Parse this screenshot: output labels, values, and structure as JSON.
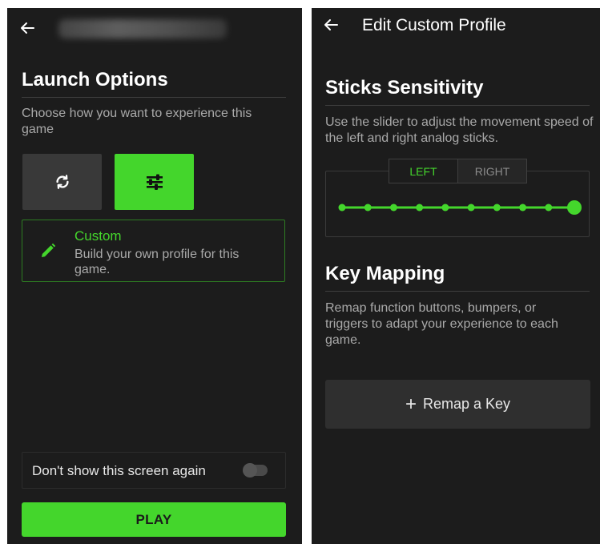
{
  "launch": {
    "heading": "Launch Options",
    "description": "Choose how you want to experience this game",
    "custom_option": {
      "title": "Custom",
      "description": "Build your own profile for this game."
    },
    "dont_show_label": "Don't show this screen again",
    "dont_show_enabled": false,
    "play_label": "PLAY",
    "icons": [
      "back-arrow-icon",
      "sync-icon",
      "sliders-icon",
      "pencil-icon"
    ]
  },
  "profile": {
    "title": "Edit Custom Profile",
    "sticks": {
      "heading": "Sticks Sensitivity",
      "description": "Use the slider to adjust the movement speed of the left and right analog sticks.",
      "tabs": [
        "LEFT",
        "RIGHT"
      ],
      "selected_tab": "LEFT",
      "slider_steps": 10,
      "slider_value": 10
    },
    "key_mapping": {
      "heading": "Key Mapping",
      "description": "Remap function buttons, bumpers, or triggers to adapt your experience to each game.",
      "remap_label": "Remap a Key",
      "remap_icon": "plus-icon"
    }
  },
  "colors": {
    "accent": "#44d62c",
    "background": "#1c1c1c",
    "button_dark": "#393939"
  }
}
